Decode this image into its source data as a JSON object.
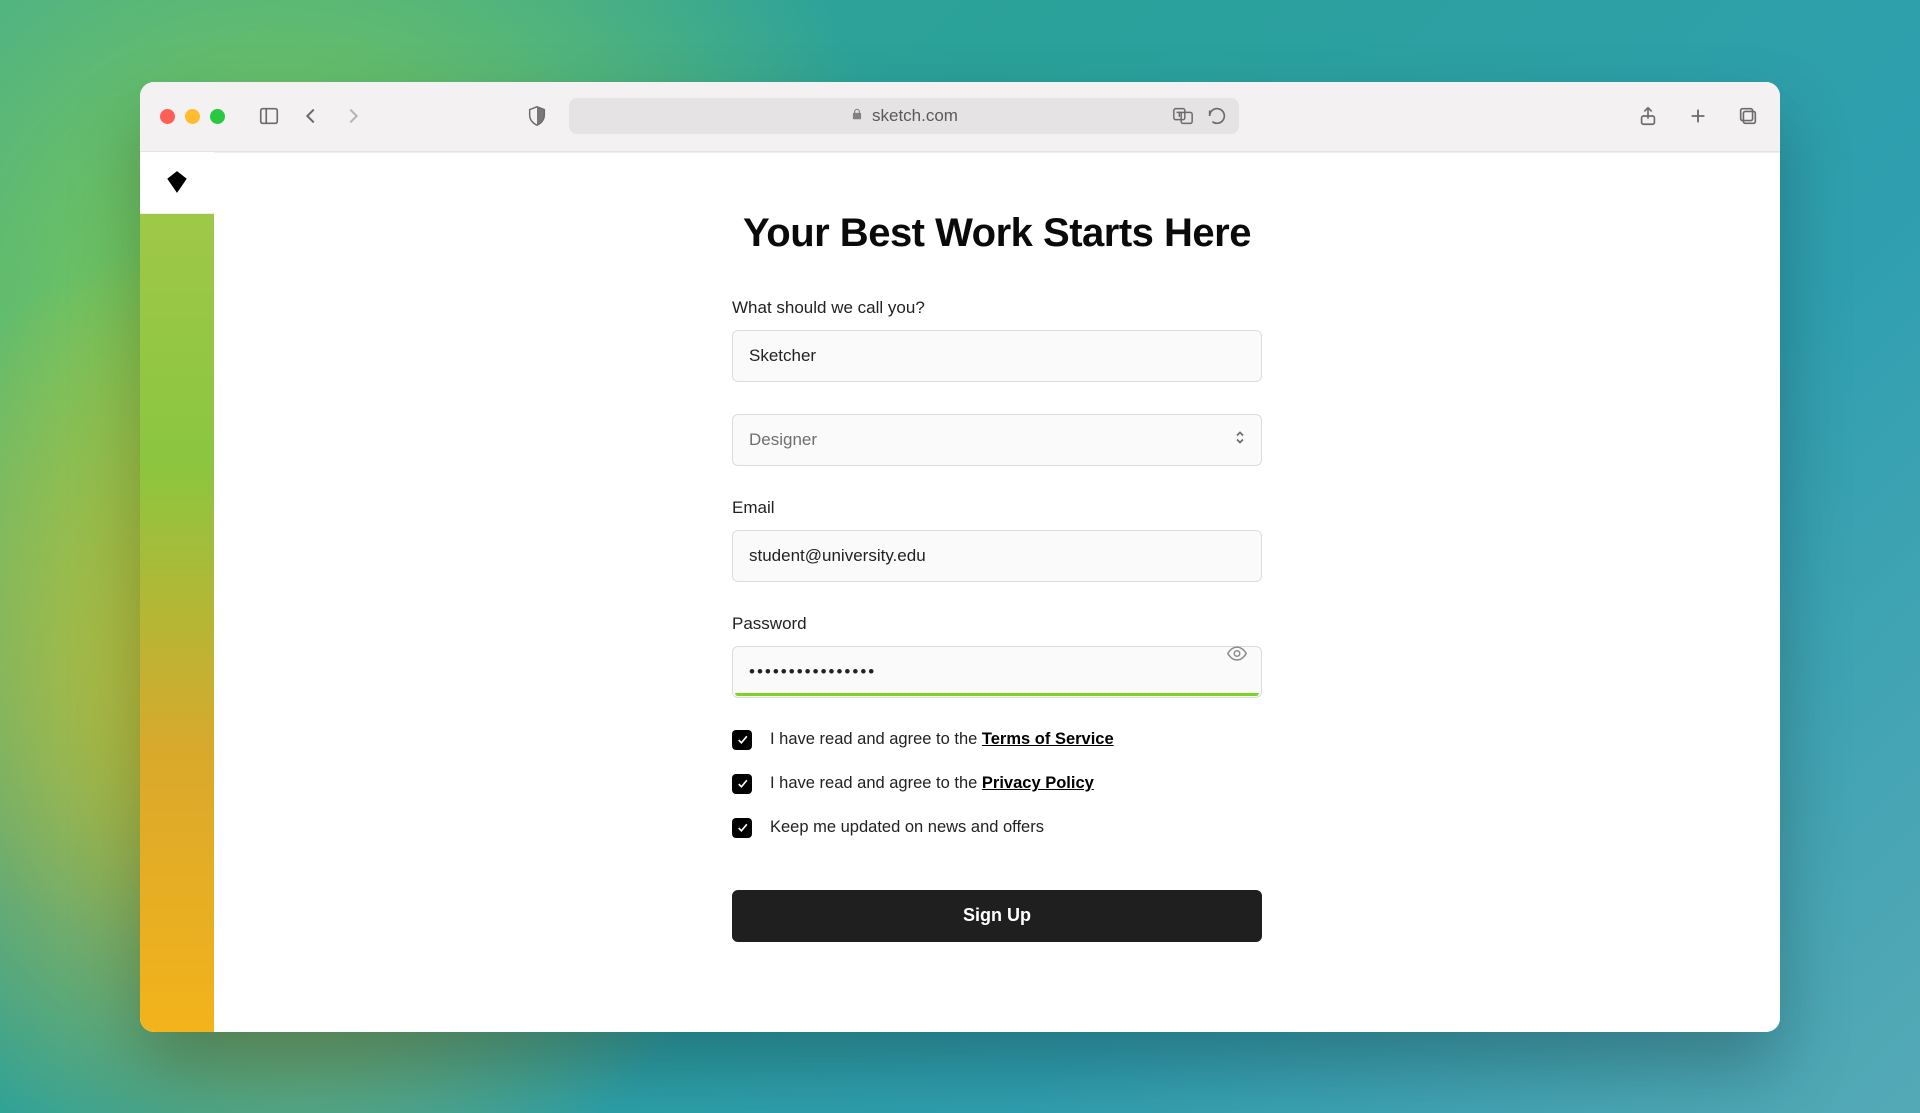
{
  "browser": {
    "url_host": "sketch.com"
  },
  "page": {
    "heading": "Your Best Work Starts Here"
  },
  "form": {
    "name": {
      "label": "What should we call you?",
      "value": "Sketcher"
    },
    "role": {
      "selected": "Designer"
    },
    "email": {
      "label": "Email",
      "value": "student@university.edu"
    },
    "password": {
      "label": "Password",
      "value_masked": "••••••••••••••••"
    },
    "checks": {
      "tos_prefix": "I have read and agree to the ",
      "tos_link": "Terms of Service",
      "privacy_prefix": "I have read and agree to the ",
      "privacy_link": "Privacy Policy",
      "updates_label": "Keep me updated on news and offers"
    },
    "submit_label": "Sign Up"
  }
}
